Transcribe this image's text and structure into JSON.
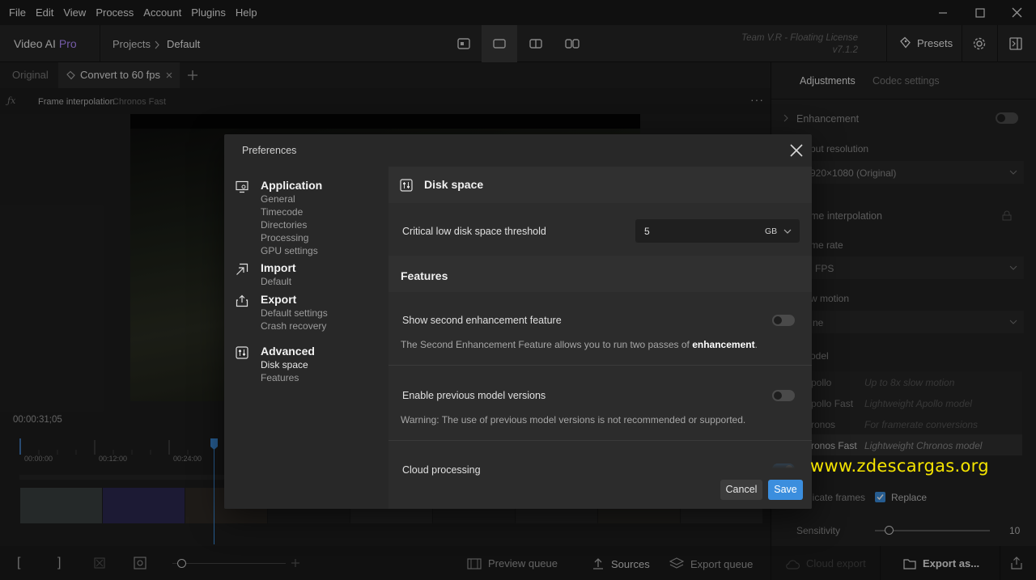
{
  "menubar": {
    "items": [
      "File",
      "Edit",
      "View",
      "Process",
      "Account",
      "Plugins",
      "Help"
    ]
  },
  "header": {
    "app_name": "Video AI",
    "app_tier": "Pro",
    "crumb_projects": "Projects",
    "crumb_current": "Default",
    "license_line1": "Team V.R - Floating License",
    "license_line2": "v7.1.2",
    "presets_label": "Presets"
  },
  "tabs": {
    "original": "Original",
    "active": "Convert to 60 fps"
  },
  "fxbar": {
    "filter": "Frame interpolation",
    "model": "Chronos Fast"
  },
  "timeline": {
    "timecode": "00:00:31;05",
    "ticks": [
      "00:00:00",
      "00:12:00",
      "00:24:00"
    ]
  },
  "bottombar": {
    "preview_queue": "Preview queue",
    "sources": "Sources",
    "export_queue": "Export queue",
    "cloud_export": "Cloud export",
    "export_as": "Export as..."
  },
  "rightpanel": {
    "tabs": [
      "Adjustments",
      "Codec settings"
    ],
    "enhancement": "Enhancement",
    "output_resolution_label": "put resolution",
    "output_resolution_value": "920×1080 (Original)",
    "frame_interp_label": "me interpolation",
    "frame_rate_label": "me rate",
    "frame_rate_value": "FPS",
    "slow_motion_label": "w motion",
    "slow_motion_value": "ne",
    "model_label": "odel",
    "models": [
      {
        "name": "pollo",
        "desc": "Up to 8x slow motion"
      },
      {
        "name": "pollo Fast",
        "desc": "Lightweight Apollo model"
      },
      {
        "name": "ronos",
        "desc": "For framerate conversions"
      },
      {
        "name": "ronos Fast",
        "desc": "Lightweight Chronos model"
      }
    ],
    "duplicate_label": "licate frames",
    "replace_label": "Replace",
    "sensitivity_label": "Sensitivity",
    "sensitivity_value": "10"
  },
  "dialog": {
    "title": "Preferences",
    "sections": [
      {
        "title": "Application",
        "items": [
          "General",
          "Timecode",
          "Directories",
          "Processing",
          "GPU settings"
        ]
      },
      {
        "title": "Import",
        "items": [
          "Default"
        ]
      },
      {
        "title": "Export",
        "items": [
          "Default settings",
          "Crash recovery"
        ]
      },
      {
        "title": "Advanced",
        "items": [
          "Disk space",
          "Features"
        ]
      }
    ],
    "disk_space_heading": "Disk space",
    "threshold_label": "Critical low disk space threshold",
    "threshold_value": "5",
    "threshold_unit": "GB",
    "features_heading": "Features",
    "second_enh_label": "Show second enhancement feature",
    "second_enh_desc_pre": "The Second Enhancement Feature allows you to run two passes of ",
    "second_enh_desc_bold": "enhancement",
    "second_enh_desc_post": ".",
    "prev_models_label": "Enable previous model versions",
    "prev_models_desc": "Warning: The use of previous model versions is not recommended or supported.",
    "cloud_label": "Cloud processing",
    "cancel": "Cancel",
    "save": "Save"
  },
  "watermark": "www.zdescargas.org"
}
